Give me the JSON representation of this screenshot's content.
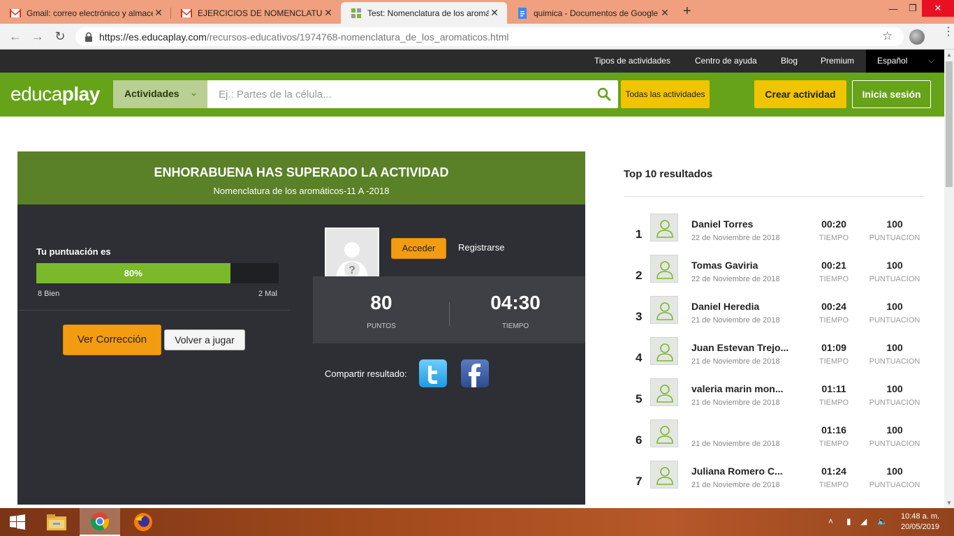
{
  "browser": {
    "tabs": [
      {
        "title": "Gmail: correo electrónico y almacenamiento",
        "icon": "gmail-icon",
        "active": false
      },
      {
        "title": "EJERCICIOS DE NOMENCLATURA",
        "icon": "gmail-icon",
        "active": false
      },
      {
        "title": "Test: Nomenclatura de los aromáticos",
        "icon": "educaplay-icon",
        "active": true
      },
      {
        "title": "quimica - Documentos de Google",
        "icon": "google-docs-icon",
        "active": false
      }
    ],
    "close_glyph": "✕",
    "new_tab_glyph": "+",
    "url_host": "https://es.educaplay.com",
    "url_path": "/recursos-educativos/1974768-nomenclatura_de_los_aromaticos.html"
  },
  "topbar": {
    "links": [
      "Tipos de actividades",
      "Centro de ayuda",
      "Blog",
      "Premium"
    ],
    "language": "Español"
  },
  "header": {
    "logo_light": "educa",
    "logo_bold": "play",
    "category_label": "Actividades",
    "search_placeholder": "Ej.: Partes de la célula...",
    "all_activities": "Todas las actividades",
    "create_activity": "Crear actividad",
    "login": "Inicia sesión"
  },
  "result": {
    "title": "ENHORABUENA HAS SUPERADO LA ACTIVIDAD",
    "subtitle": "Nomenclatura de los aromáticos-11 A -2018",
    "score_label": "Tu puntuación es",
    "score_percent_text": "80%",
    "score_fraction": 0.8,
    "correct_label": "8 Bien",
    "wrong_label": "2 Mal",
    "review_button": "Ver Corrección",
    "replay_button": "Volver a jugar",
    "access_button": "Acceder",
    "register_link": "Registrarse",
    "points_value": "80",
    "points_label": "PUNTOS",
    "time_value": "04:30",
    "time_label": "TIEMPO",
    "share_label": "Compartir resultado:",
    "colors": {
      "success_green": "#5a8127",
      "bar_green": "#7ab92a",
      "orange": "#f39c12"
    }
  },
  "top10": {
    "title": "Top 10 resultados",
    "time_label": "TIEMPO",
    "points_label": "PUNTUACION",
    "rows": [
      {
        "rank": "1",
        "name": "Daniel Torres",
        "date": "22 de Noviembre de 2018",
        "time": "00:20",
        "points": "100"
      },
      {
        "rank": "2",
        "name": "Tomas Gaviria",
        "date": "22 de Noviembre de 2018",
        "time": "00:21",
        "points": "100"
      },
      {
        "rank": "3",
        "name": "Daniel Heredia",
        "date": "21 de Noviembre de 2018",
        "time": "00:24",
        "points": "100"
      },
      {
        "rank": "4",
        "name": "Juan Estevan Trejo...",
        "date": "21 de Noviembre de 2018",
        "time": "01:09",
        "points": "100"
      },
      {
        "rank": "5",
        "name": "valeria marin mon...",
        "date": "21 de Noviembre de 2018",
        "time": "01:11",
        "points": "100"
      },
      {
        "rank": "6",
        "name": "",
        "date": "21 de Noviembre de 2018",
        "time": "01:16",
        "points": "100"
      },
      {
        "rank": "7",
        "name": "Juliana Romero C...",
        "date": "21 de Noviembre de 2018",
        "time": "01:24",
        "points": "100"
      }
    ]
  },
  "taskbar": {
    "clock_time": "10:48 a. m.",
    "clock_date": "20/05/2019"
  }
}
